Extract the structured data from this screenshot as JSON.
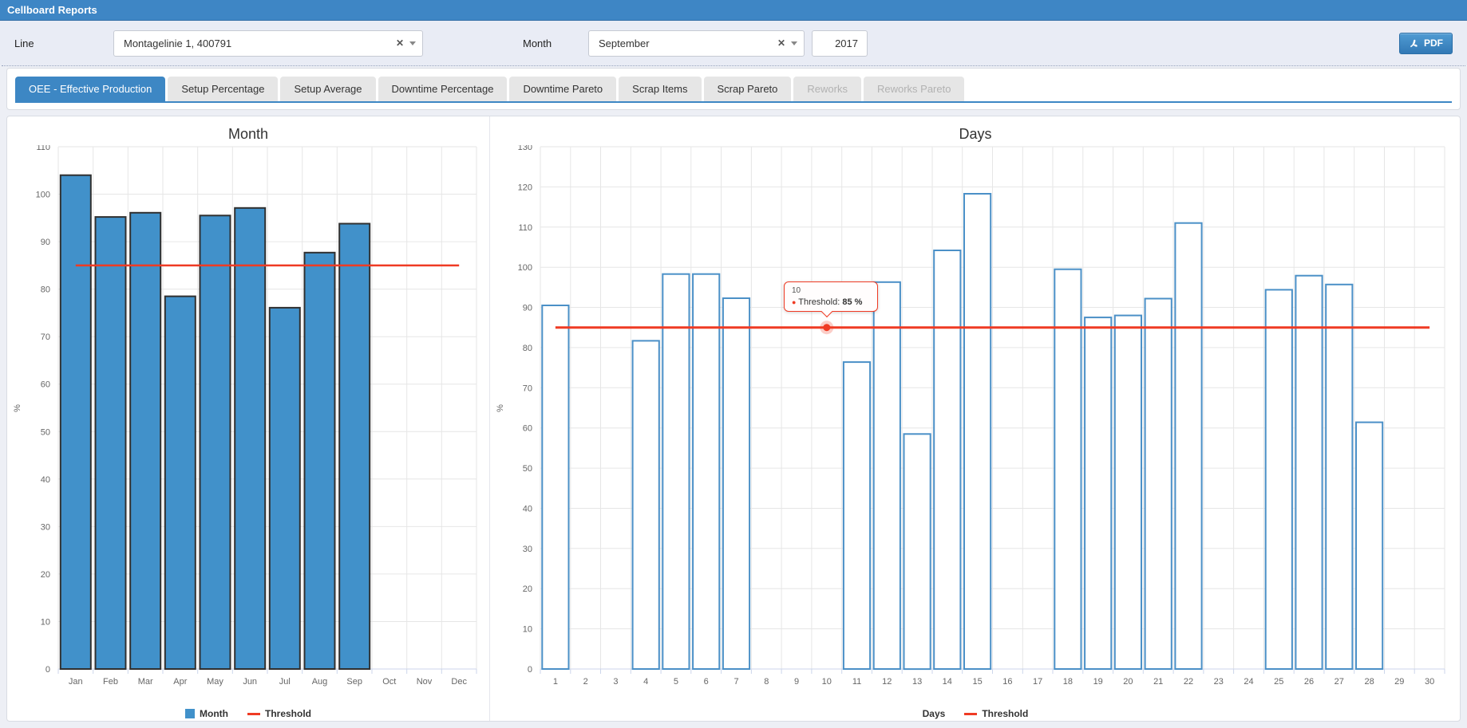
{
  "header": {
    "title": "Cellboard Reports"
  },
  "filters": {
    "line_label": "Line",
    "line_value": "Montagelinie 1, 400791",
    "month_label": "Month",
    "month_value": "September",
    "year_value": "2017",
    "clear_icon": "✕",
    "pdf_label": "PDF"
  },
  "tabs": [
    {
      "label": "OEE - Effective Production",
      "state": "active"
    },
    {
      "label": "Setup Percentage",
      "state": "normal"
    },
    {
      "label": "Setup Average",
      "state": "normal"
    },
    {
      "label": "Downtime Percentage",
      "state": "normal"
    },
    {
      "label": "Downtime Pareto",
      "state": "normal"
    },
    {
      "label": "Scrap Items",
      "state": "normal"
    },
    {
      "label": "Scrap Pareto",
      "state": "normal"
    },
    {
      "label": "Reworks",
      "state": "disabled"
    },
    {
      "label": "Reworks Pareto",
      "state": "disabled"
    }
  ],
  "colors": {
    "header_bg": "#3e86c5",
    "accent_blue": "#3d87c4",
    "bar_fill": "#4191ca",
    "bar_outline": "#4b90c7",
    "threshold_red": "#ef3b24",
    "grid": "#e6e6e6",
    "axis_line": "#ccd6eb"
  },
  "chart_data": [
    {
      "type": "bar",
      "title": "Month",
      "xlabel": "",
      "ylabel": "%",
      "ylim": [
        0,
        110
      ],
      "ytick": 10,
      "grid": true,
      "legend_position": "bottom",
      "bar_style": "filled",
      "categories": [
        "Jan",
        "Feb",
        "Mar",
        "Apr",
        "May",
        "Jun",
        "Jul",
        "Aug",
        "Sep",
        "Oct",
        "Nov",
        "Dec"
      ],
      "series": [
        {
          "name": "Month",
          "values": [
            104,
            95.2,
            96.1,
            78.5,
            95.5,
            97.1,
            76.1,
            87.7,
            93.8,
            null,
            null,
            null
          ]
        }
      ],
      "threshold": {
        "name": "Threshold",
        "value": 85
      }
    },
    {
      "type": "bar",
      "title": "Days",
      "xlabel": "Days",
      "ylabel": "%",
      "ylim": [
        0,
        130
      ],
      "ytick": 10,
      "grid": true,
      "legend_position": "bottom",
      "bar_style": "outline",
      "categories": [
        "1",
        "2",
        "3",
        "4",
        "5",
        "6",
        "7",
        "8",
        "9",
        "10",
        "11",
        "12",
        "13",
        "14",
        "15",
        "16",
        "17",
        "18",
        "19",
        "20",
        "21",
        "22",
        "23",
        "24",
        "25",
        "26",
        "27",
        "28",
        "29",
        "30"
      ],
      "series": [
        {
          "name": "Days",
          "values": [
            90.5,
            null,
            null,
            81.7,
            98.3,
            98.3,
            92.3,
            null,
            null,
            null,
            76.4,
            96.3,
            58.5,
            104.2,
            118.3,
            null,
            null,
            99.5,
            87.5,
            88,
            92.2,
            111,
            null,
            null,
            94.4,
            97.9,
            95.7,
            61.4,
            null,
            null
          ]
        }
      ],
      "threshold": {
        "name": "Threshold",
        "value": 85
      },
      "tooltip": {
        "category": "10",
        "label": "Threshold:",
        "value": "85 %"
      }
    }
  ]
}
